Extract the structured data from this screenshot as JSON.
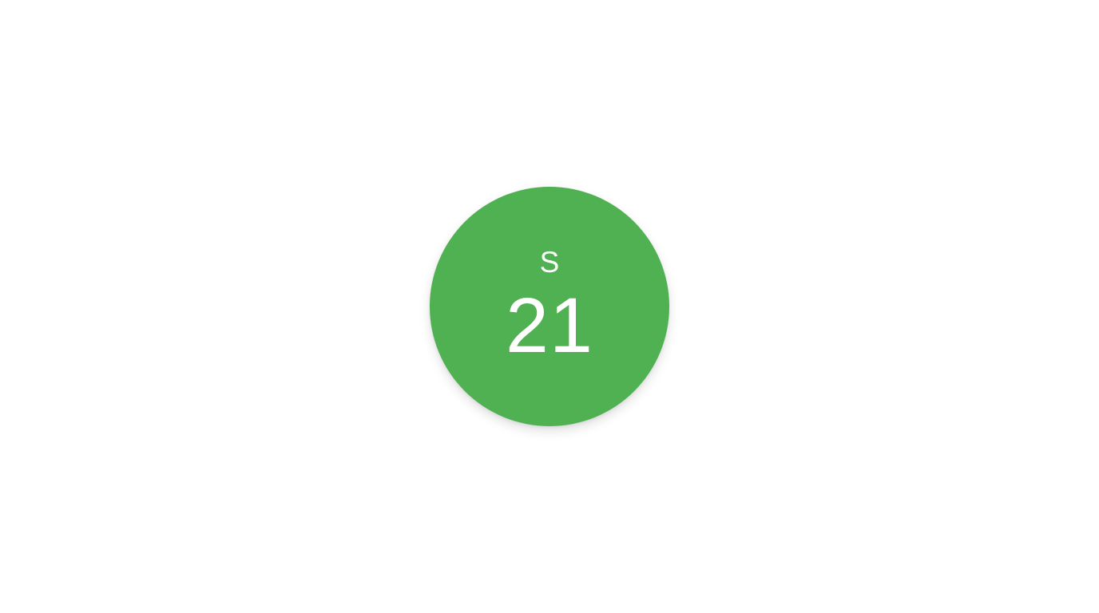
{
  "day_badge": {
    "weekday_letter": "S",
    "day_number": "21",
    "background_color": "#50b153",
    "text_color": "#ffffff"
  }
}
